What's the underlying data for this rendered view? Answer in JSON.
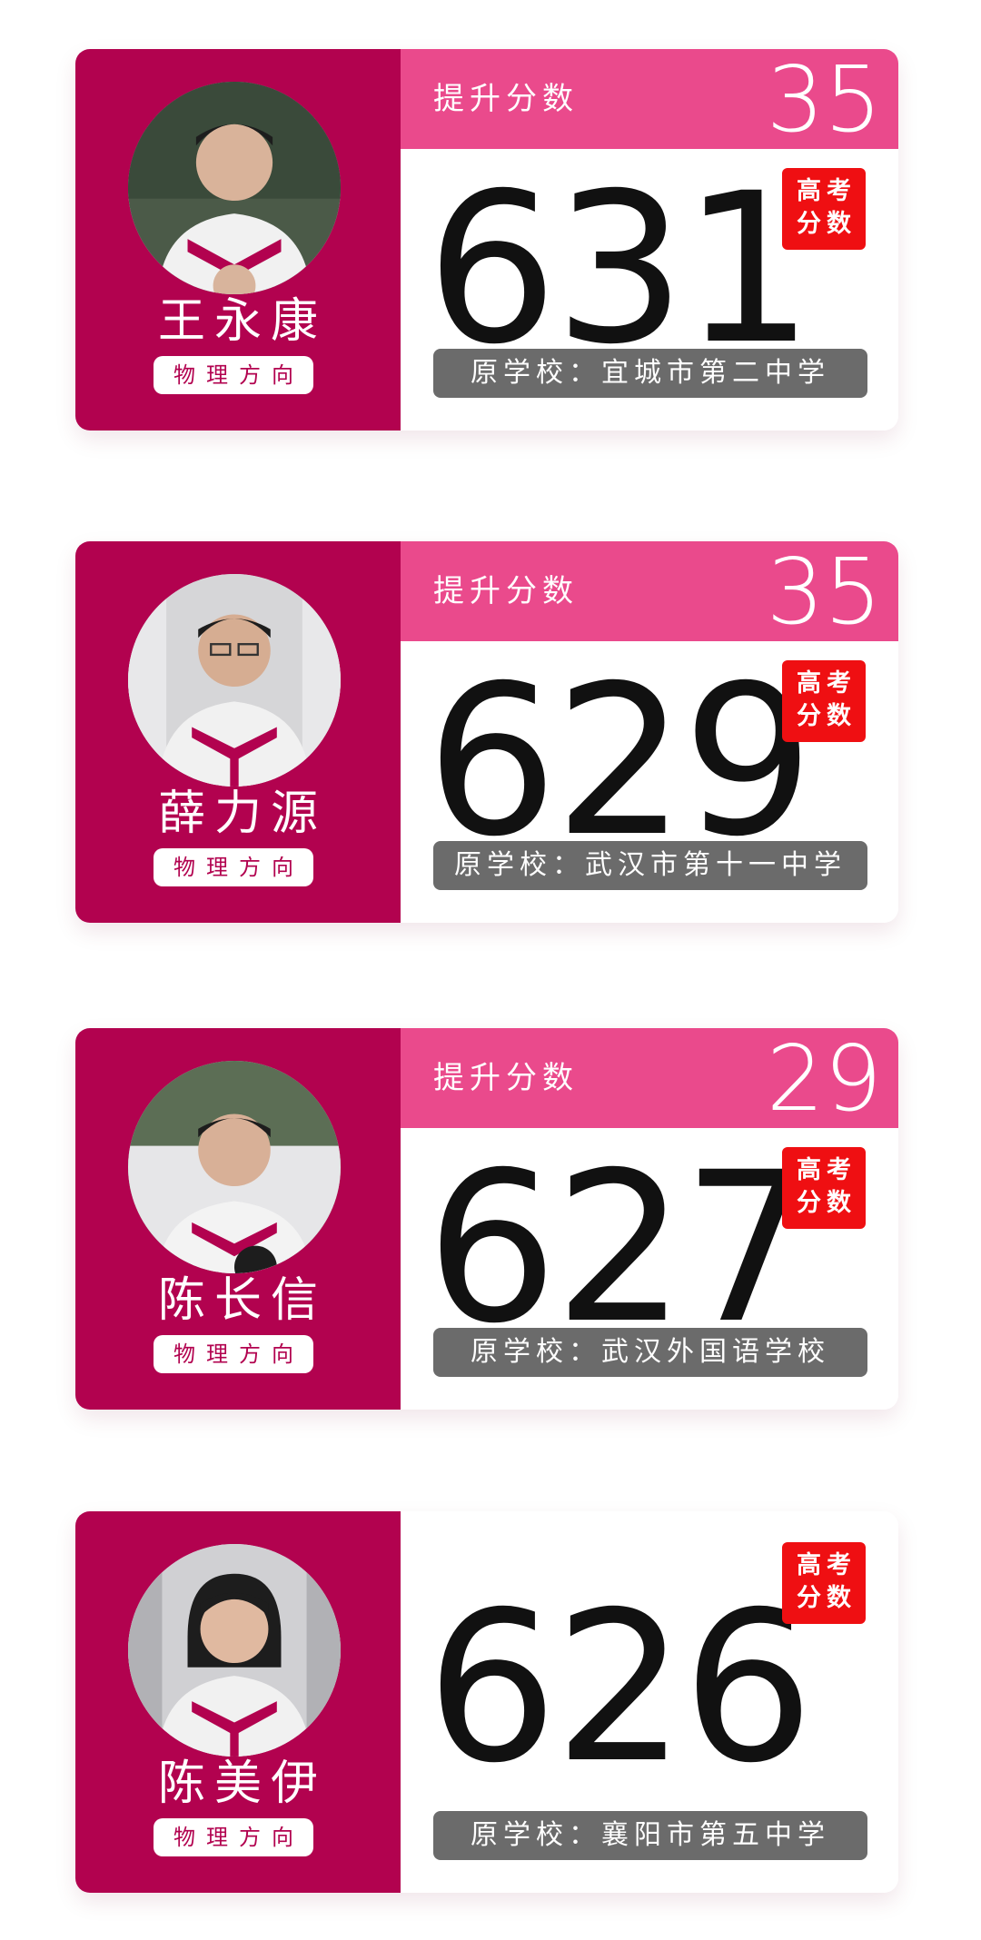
{
  "students": [
    {
      "name": "王永康",
      "tag": "物理方向",
      "improvement_label": "提升分数",
      "improvement": "35",
      "score": "631",
      "badge_line1": "高考",
      "badge_line2": "分数",
      "school": "原学校：宜城市第二中学"
    },
    {
      "name": "薛力源",
      "tag": "物理方向",
      "improvement_label": "提升分数",
      "improvement": "35",
      "score": "629",
      "badge_line1": "高考",
      "badge_line2": "分数",
      "school": "原学校：武汉市第十一中学"
    },
    {
      "name": "陈长信",
      "tag": "物理方向",
      "improvement_label": "提升分数",
      "improvement": "29",
      "score": "627",
      "badge_line1": "高考",
      "badge_line2": "分数",
      "school": "原学校：武汉外国语学校"
    },
    {
      "name": "陈美伊",
      "tag": "物理方向",
      "score": "626",
      "badge_line1": "高考",
      "badge_line2": "分数",
      "school": "原学校：襄阳市第五中学"
    }
  ],
  "colors": {
    "left_panel": "#b2024f",
    "band": "#ea4a8c",
    "badge": "#ef0f12",
    "school_bar": "#6b6b6b"
  }
}
